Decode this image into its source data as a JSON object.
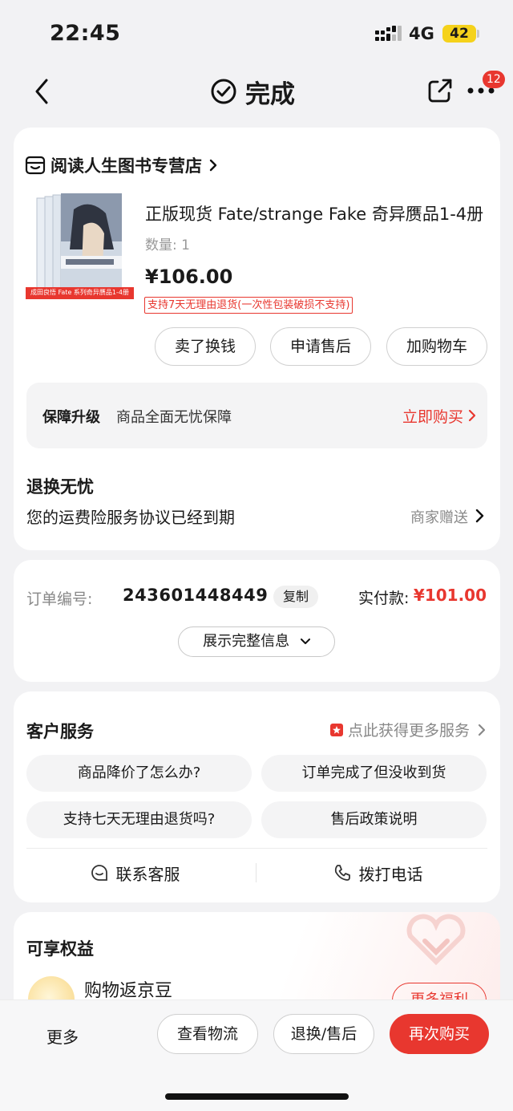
{
  "status_bar": {
    "time": "22:45",
    "network": "4G",
    "battery": "42"
  },
  "nav": {
    "title": "完成",
    "badge_count": "12"
  },
  "product_card": {
    "shop_name": "阅读人生图书专营店",
    "book_banner": "成田良悟 Fate 系列奇异赝品1-4册",
    "title": "正版现货 Fate/strange Fake 奇异赝品1-4册",
    "quantity": "数量: 1",
    "price": "¥106.00",
    "return_tag": "支持7天无理由退货(一次性包装破损不支持)",
    "buttons": {
      "sell": "卖了换钱",
      "after_sale": "申请售后",
      "add_cart": "加购物车"
    },
    "guarantee": {
      "label": "保障升级",
      "text": "商品全面无忧保障",
      "action": "立即购买"
    },
    "worry_free": {
      "title": "退换无忧",
      "text": "您的运费险服务协议已经到期",
      "right": "商家赠送"
    }
  },
  "order_card": {
    "order_label": "订单编号:",
    "order_no": "243601448449",
    "copy_label": "复制",
    "paid_label": "实付款:",
    "paid_value": "¥101.00",
    "expand_label": "展示完整信息"
  },
  "customer_service": {
    "title": "客户服务",
    "more": "点此获得更多服务",
    "faqs": [
      "商品降价了怎么办?",
      "订单完成了但没收到货",
      "支持七天无理由退货吗?",
      "售后政策说明"
    ],
    "contact": "联系客服",
    "call": "拨打电话"
  },
  "benefits": {
    "title": "可享权益",
    "item": "购物返京豆",
    "button": "更多福利"
  },
  "bottom_bar": {
    "more": "更多",
    "logistics": "查看物流",
    "return": "退换/售后",
    "rebuy": "再次购买"
  },
  "colors": {
    "accent": "#e8372f",
    "battery": "#f5d21b",
    "background": "#f2f2f4"
  }
}
